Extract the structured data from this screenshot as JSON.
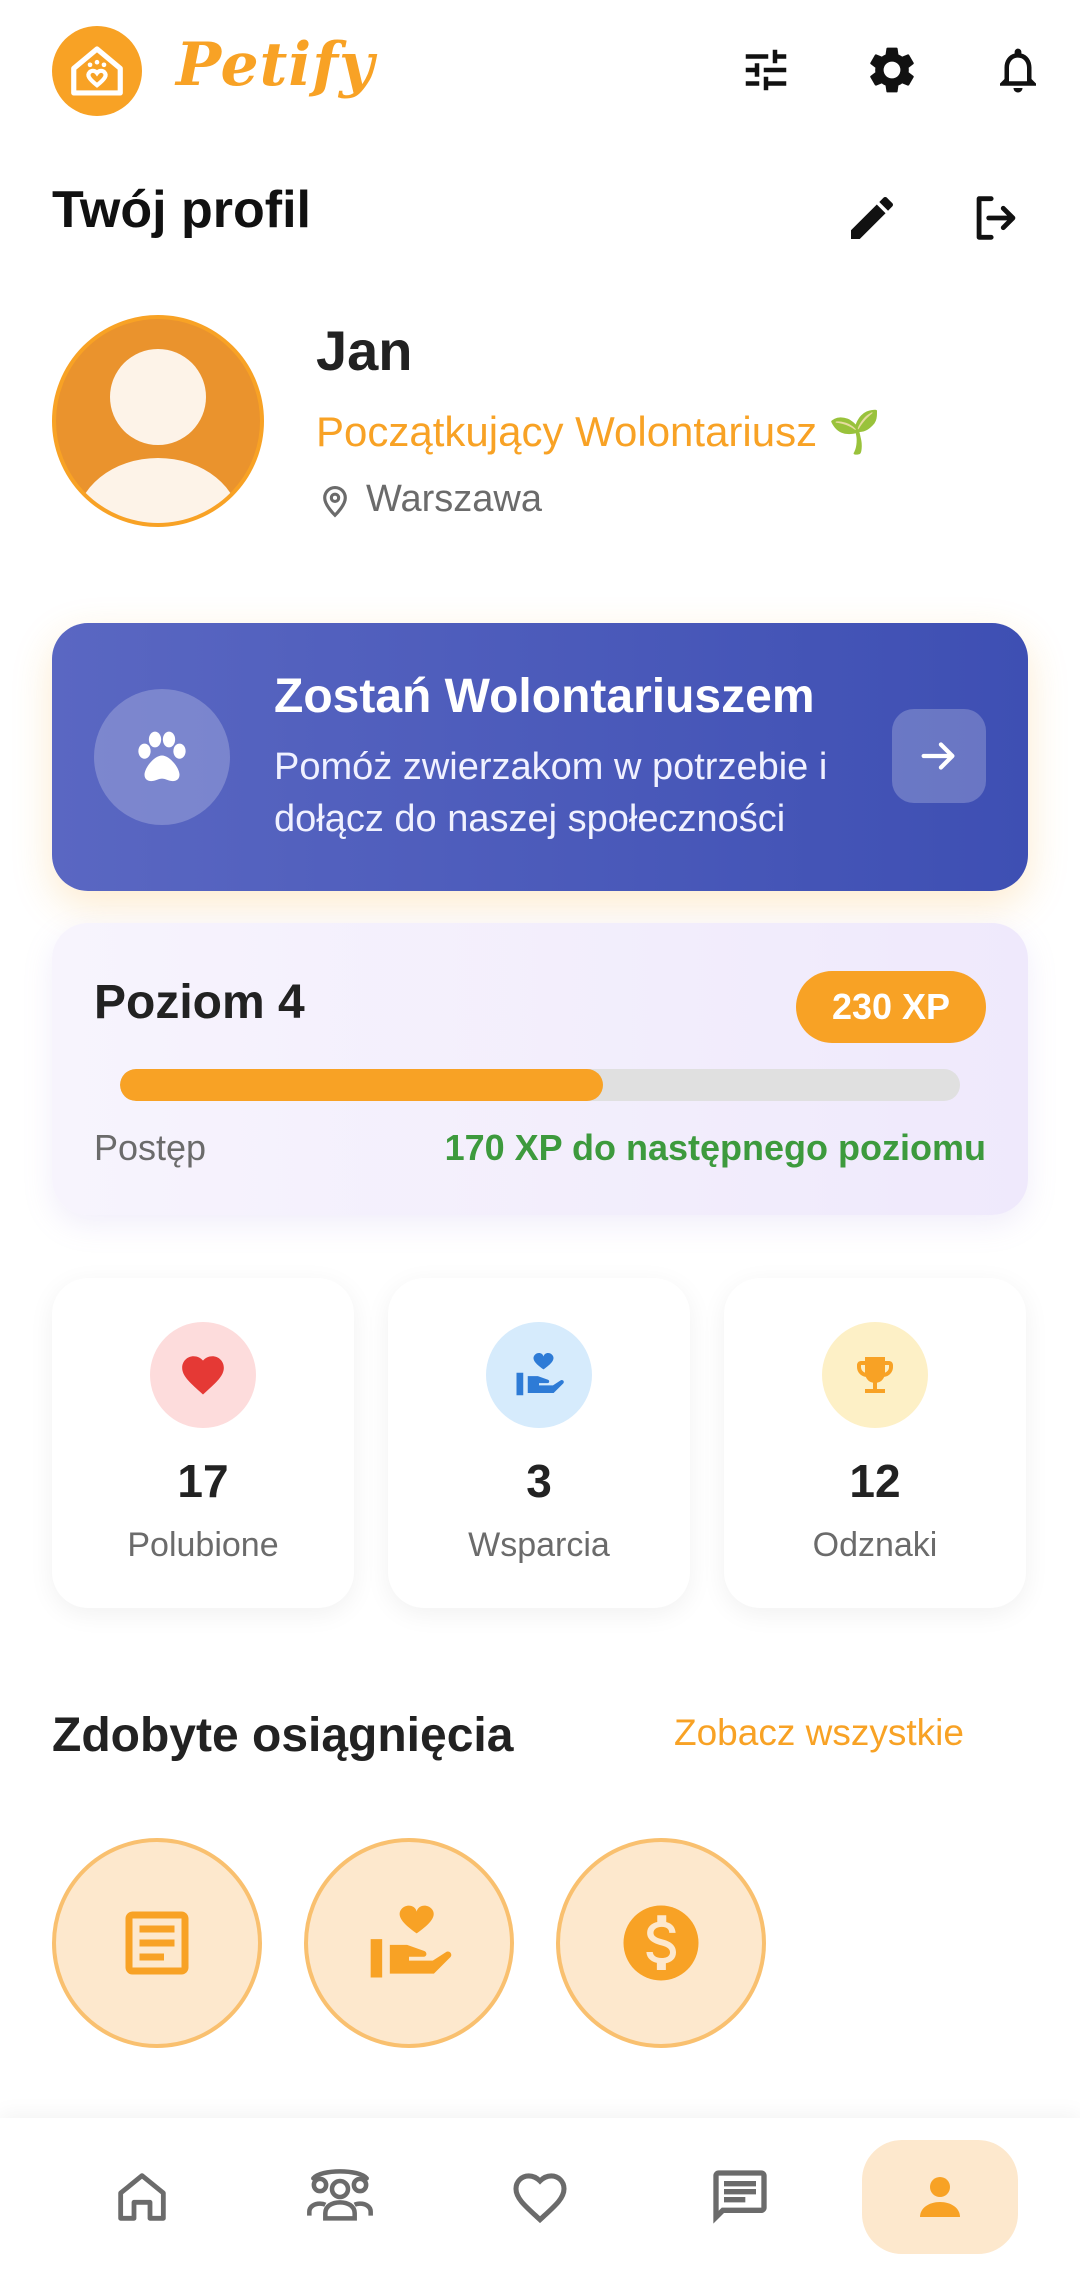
{
  "app": {
    "name": "Petify"
  },
  "header": {
    "icons": [
      "tune-icon",
      "gear-icon",
      "bell-icon"
    ]
  },
  "profile": {
    "title": "Twój profil",
    "name": "Jan",
    "rank": "Początkujący Wolontariusz 🌱",
    "city": "Warszawa"
  },
  "volunteer": {
    "title": "Zostań Wolontariuszem",
    "description": "Pomóż zwierzakom w potrzebie i dołącz do naszej społeczności"
  },
  "level": {
    "title": "Poziom 4",
    "xp": "230 XP",
    "progress_fraction": 0.575,
    "progress_label": "Postęp",
    "next_level": "170 XP do następnego poziomu"
  },
  "stats": [
    {
      "value": "17",
      "label": "Polubione",
      "icon": "heart-icon"
    },
    {
      "value": "3",
      "label": "Wsparcia",
      "icon": "helping-hand-icon"
    },
    {
      "value": "12",
      "label": "Odznaki",
      "icon": "trophy-icon"
    }
  ],
  "achievements": {
    "title": "Zdobyte osiągnięcia",
    "see_all": "Zobacz wszystkie",
    "items": [
      "document-icon",
      "helping-hand-icon",
      "dollar-icon"
    ]
  },
  "nav": {
    "items": [
      "home-icon",
      "community-icon",
      "favorites-icon",
      "chat-icon",
      "profile-icon"
    ],
    "active": "profile-icon"
  },
  "colors": {
    "brand": "#F8A225",
    "volunteer_card": "#4A58BA",
    "success": "#3D9A3D",
    "heart": "#E53935",
    "support": "#2E7BD6",
    "trophy": "#F8A225"
  }
}
